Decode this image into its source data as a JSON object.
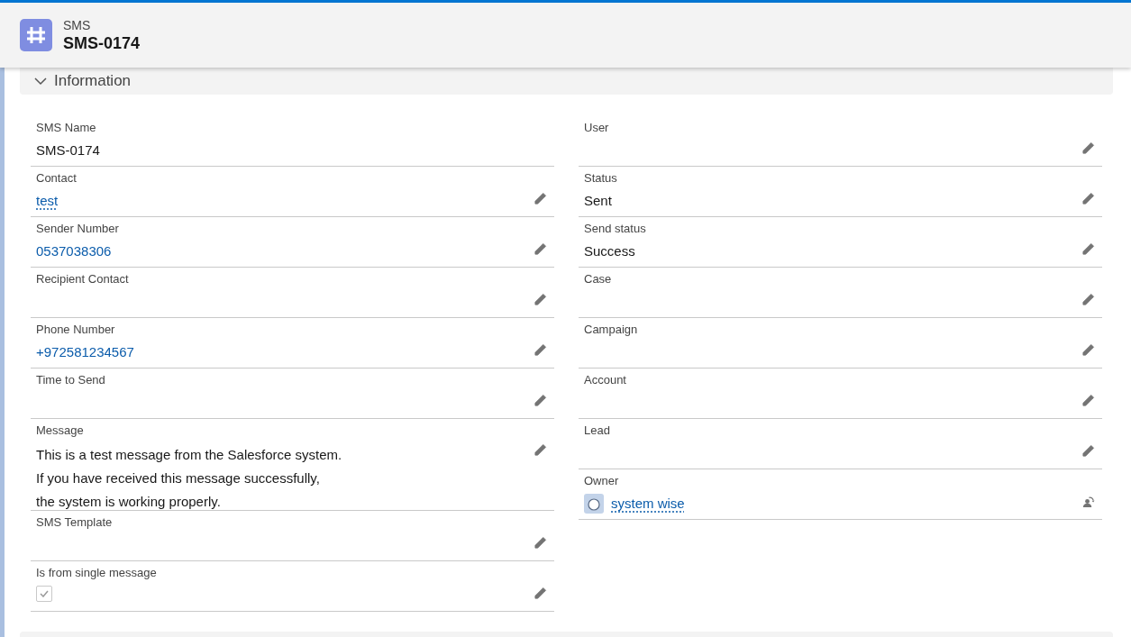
{
  "header": {
    "object_type": "SMS",
    "title": "SMS-0174"
  },
  "section": {
    "title": "Information",
    "expanded": true
  },
  "left_fields": [
    {
      "label": "SMS Name",
      "kind": "text",
      "value": "SMS-0174",
      "editable": false
    },
    {
      "label": "Contact",
      "kind": "lookup",
      "value": "test",
      "editable": true
    },
    {
      "label": "Sender Number",
      "kind": "phone",
      "value": "0537038306",
      "editable": true
    },
    {
      "label": "Recipient Contact",
      "kind": "text",
      "editable": true
    },
    {
      "label": "Phone Number",
      "kind": "phone",
      "value": "+972581234567",
      "editable": true
    },
    {
      "label": "Time to Send",
      "kind": "text",
      "editable": true
    },
    {
      "label": "Message",
      "kind": "multiline",
      "lines": [
        "This is a test message from the Salesforce system.",
        "If you have received this message successfully,",
        "the system is working properly."
      ],
      "editable": true
    },
    {
      "label": "SMS Template",
      "kind": "text",
      "editable": true
    },
    {
      "label": "Is from single message",
      "kind": "checkbox",
      "checked": true,
      "editable": true
    }
  ],
  "right_fields": [
    {
      "label": "User",
      "kind": "text",
      "editable": true
    },
    {
      "label": "Status",
      "kind": "text",
      "value": "Sent",
      "editable": true
    },
    {
      "label": "Send status",
      "kind": "text",
      "value": "Success",
      "editable": true
    },
    {
      "label": "Case",
      "kind": "text",
      "editable": true
    },
    {
      "label": "Campaign",
      "kind": "text",
      "editable": true
    },
    {
      "label": "Account",
      "kind": "text",
      "editable": true
    },
    {
      "label": "Lead",
      "kind": "text",
      "editable": true
    },
    {
      "label": "Owner",
      "kind": "owner",
      "value": "system wise",
      "editable": true
    }
  ]
}
